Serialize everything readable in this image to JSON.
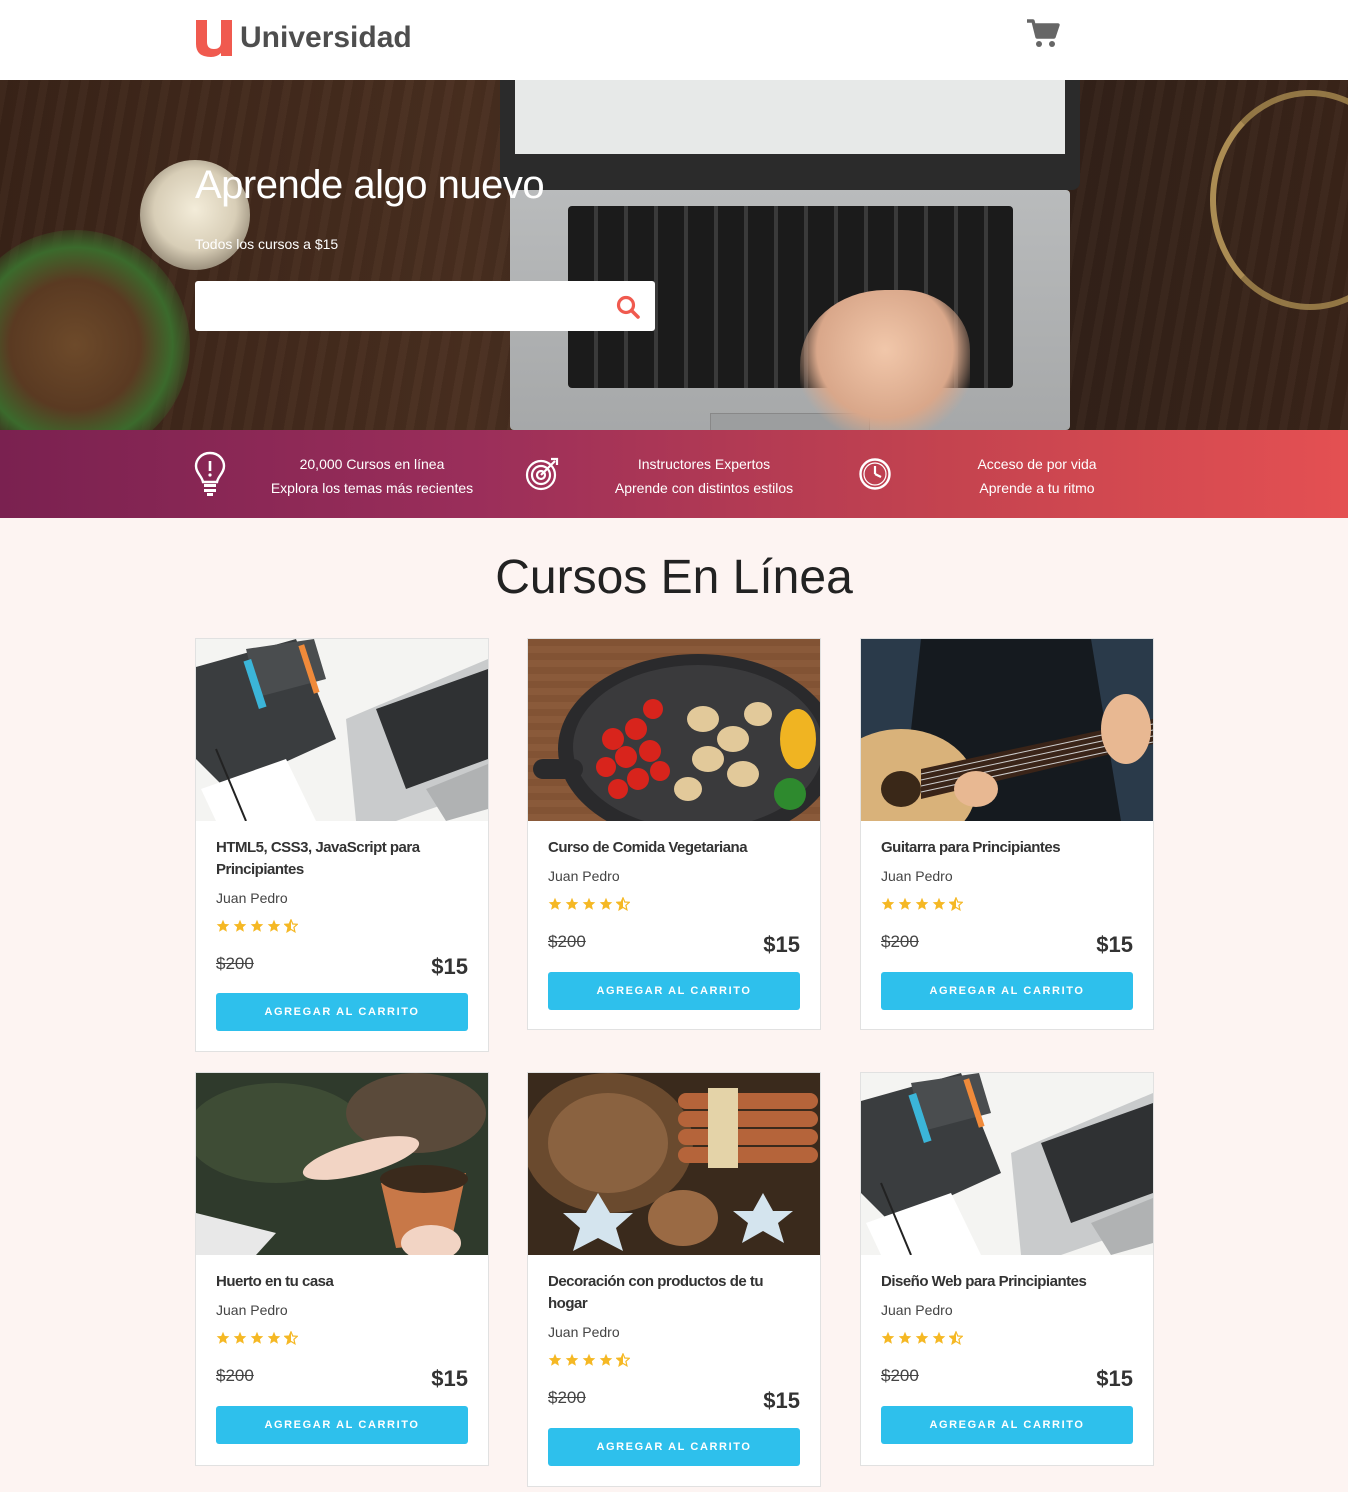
{
  "header": {
    "logo_text": "Universidad",
    "brand_color": "#f05a4f"
  },
  "hero": {
    "title": "Aprende algo nuevo",
    "subtitle": "Todos los cursos a $15",
    "search": {
      "value": "",
      "placeholder": ""
    }
  },
  "features": [
    {
      "icon": "lightbulb-icon",
      "line1": "20,000 Cursos en línea",
      "line2": "Explora los temas más recientes"
    },
    {
      "icon": "target-icon",
      "line1": "Instructores Expertos",
      "line2": "Aprende con distintos estilos"
    },
    {
      "icon": "clock-icon",
      "line1": "Acceso de por vida",
      "line2": "Aprende a tu ritmo"
    }
  ],
  "section_title": "Cursos En Línea",
  "courses": [
    {
      "title": "HTML5, CSS3, JavaScript para Principiantes",
      "author": "Juan Pedro",
      "rating": 4.5,
      "old_price": "$200",
      "price": "$15",
      "button": "AGREGAR AL CARRITO",
      "image": "html-css-book-laptop"
    },
    {
      "title": "Curso de Comida Vegetariana",
      "author": "Juan Pedro",
      "rating": 4.5,
      "old_price": "$200",
      "price": "$15",
      "button": "AGREGAR AL CARRITO",
      "image": "vegetables-pan"
    },
    {
      "title": "Guitarra para Principiantes",
      "author": "Juan Pedro",
      "rating": 4.5,
      "old_price": "$200",
      "price": "$15",
      "button": "AGREGAR AL CARRITO",
      "image": "acoustic-guitar"
    },
    {
      "title": "Huerto en tu casa",
      "author": "Juan Pedro",
      "rating": 4.5,
      "old_price": "$200",
      "price": "$15",
      "button": "AGREGAR AL CARRITO",
      "image": "plant-pot-hands"
    },
    {
      "title": "Decoración con productos de tu hogar",
      "author": "Juan Pedro",
      "rating": 4.5,
      "old_price": "$200",
      "price": "$15",
      "button": "AGREGAR AL CARRITO",
      "image": "pinecone-cinnamon"
    },
    {
      "title": "Diseño Web para Principiantes",
      "author": "Juan Pedro",
      "rating": 4.5,
      "old_price": "$200",
      "price": "$15",
      "button": "AGREGAR AL CARRITO",
      "image": "html-css-book-laptop"
    }
  ],
  "colors": {
    "accent_button": "#2ec0ec",
    "star": "#f5b824",
    "features_gradient_start": "#7a2150",
    "features_gradient_end": "#e45052"
  }
}
